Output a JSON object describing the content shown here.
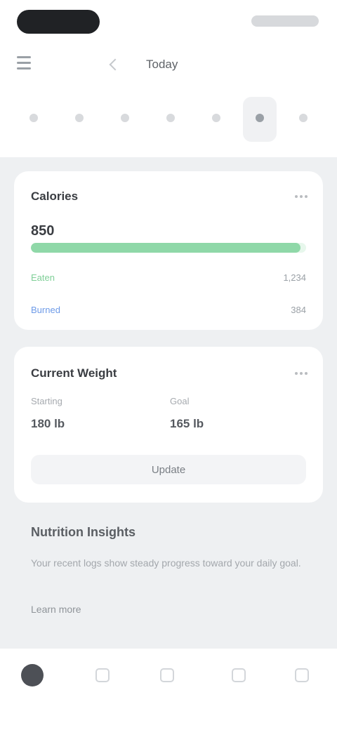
{
  "nav": {
    "title": "Today"
  },
  "days": [
    {
      "name": "day-1"
    },
    {
      "name": "day-2"
    },
    {
      "name": "day-3"
    },
    {
      "name": "day-4"
    },
    {
      "name": "day-5"
    },
    {
      "name": "day-6-selected"
    },
    {
      "name": "day-7"
    }
  ],
  "goal_card": {
    "title": "Calories",
    "value": "850",
    "progress_fraction": 0.98,
    "rows": [
      {
        "label": "Eaten",
        "value": "1,234",
        "color": "#7fcf97"
      },
      {
        "label": "Burned",
        "value": "384",
        "color": "#6e9be8"
      }
    ]
  },
  "activity_card": {
    "title": "Current Weight",
    "stats": [
      {
        "label": "Starting",
        "value": "180 lb"
      },
      {
        "label": "Goal",
        "value": "165 lb"
      }
    ],
    "button_label": "Update"
  },
  "insight": {
    "title": "Nutrition Insights",
    "body": "Your recent logs show steady progress toward your daily goal.",
    "link_label": "Learn more"
  },
  "tabs": [
    {
      "name": "home",
      "active": true
    },
    {
      "name": "diary",
      "active": false
    },
    {
      "name": "add",
      "active": false
    },
    {
      "name": "progress",
      "active": false
    },
    {
      "name": "more",
      "active": false
    }
  ],
  "colors": {
    "accent_green": "#8fd8a8",
    "background": "#eef0f2",
    "card": "#ffffff"
  }
}
